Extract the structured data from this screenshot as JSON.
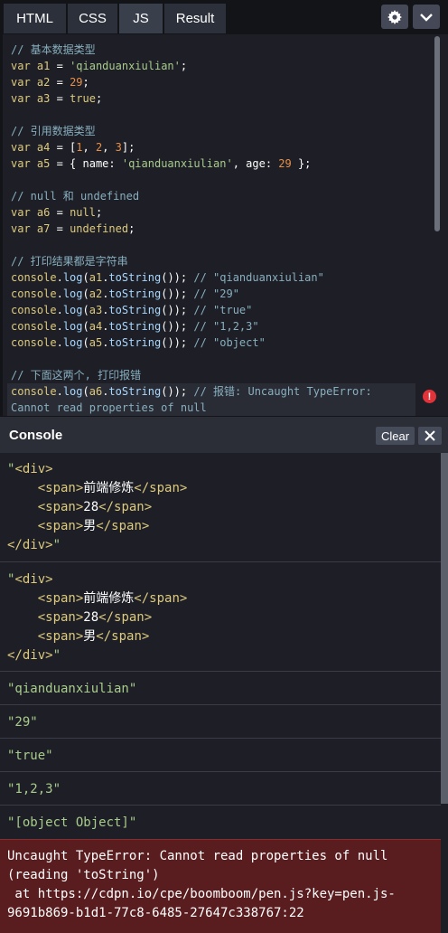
{
  "tabs": [
    {
      "label": "HTML"
    },
    {
      "label": "CSS"
    },
    {
      "label": "JS"
    },
    {
      "label": "Result"
    }
  ],
  "icons": {
    "settings": "gear-icon",
    "collapse": "chevron-down-icon",
    "error": "error-icon",
    "close": "close-icon"
  },
  "code": {
    "c1": "// 基本数据类型",
    "a1_str": "'qianduanxiulian'",
    "a2_num": "29",
    "a3_val": "true",
    "c2": "// 引用数据类型",
    "a5_str": "'qianduanxiulian'",
    "a5_num": "29",
    "c3": "// null 和 undefined",
    "a6_val": "null",
    "a7_val": "undefined",
    "c4": "// 打印结果都是字符串",
    "r1": "// \"qianduanxiulian\"",
    "r2": "// \"29\"",
    "r3": "// \"true\"",
    "r4": "// \"1,2,3\"",
    "r5": "// \"object\"",
    "c5": "// 下面这两个, 打印报错",
    "err_comment": "// 报错: Uncaught TypeError:",
    "err_comment2": "Cannot read properties of null"
  },
  "console": {
    "title": "Console",
    "clear_label": "Clear",
    "entries": [
      {
        "lines": [
          "\"<div>",
          "    <span>前端修炼</span>",
          "    <span>28</span>",
          "    <span>男</span>",
          "</div>\""
        ]
      },
      {
        "lines": [
          "\"<div>",
          "    <span>前端修炼</span>",
          "    <span>28</span>",
          "    <span>男</span>",
          "</div>\""
        ]
      },
      {
        "text": "\"qianduanxiulian\""
      },
      {
        "text": "\"29\""
      },
      {
        "text": "\"true\""
      },
      {
        "text": "\"1,2,3\""
      },
      {
        "text": "\"[object Object]\""
      }
    ],
    "error": {
      "line1": "Uncaught TypeError: Cannot read properties of null",
      "line2": "(reading 'toString')",
      "line3": " at https://cdpn.io/cpe/boomboom/pen.js?key=pen.js-",
      "line4": "9691b869-b1d1-77c8-6485-27647c338767:22"
    }
  },
  "colors": {
    "error_bg": "#5a1d1f",
    "string": "#a8cc8c",
    "keyword": "#ddca7e",
    "number": "#e88f47"
  }
}
